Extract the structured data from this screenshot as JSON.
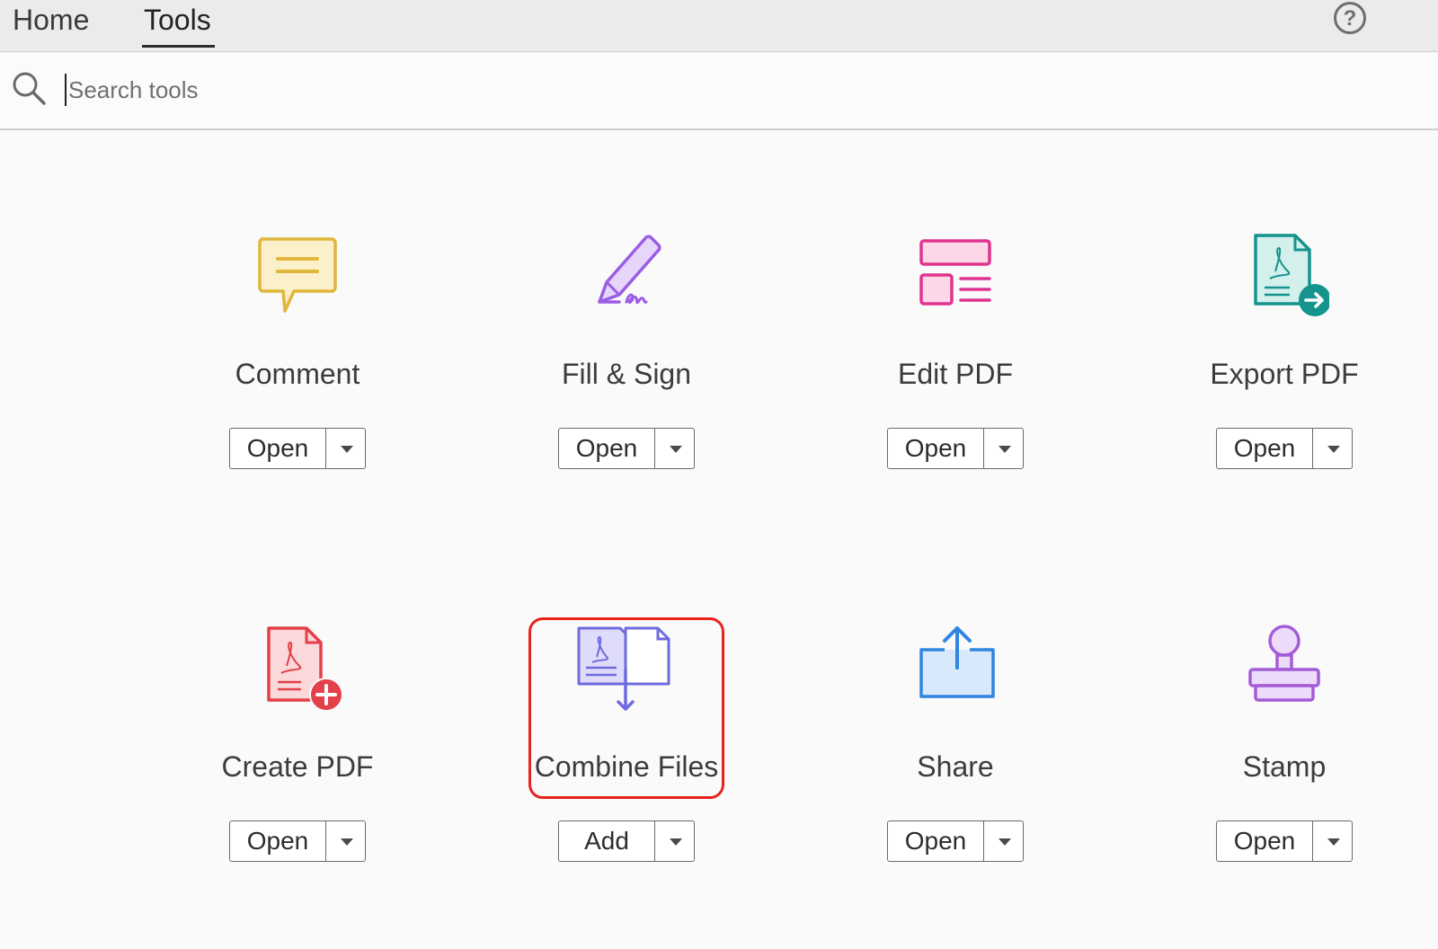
{
  "tabs": {
    "home": "Home",
    "tools": "Tools",
    "active": "Tools"
  },
  "help": {
    "icon": "help-icon",
    "glyph": "?"
  },
  "search": {
    "placeholder": "Search tools",
    "value": ""
  },
  "tools": [
    {
      "name": "Comment",
      "button": "Open",
      "icon": "comment-icon",
      "color": "#e0b73a"
    },
    {
      "name": "Fill & Sign",
      "button": "Open",
      "icon": "fill-sign-icon",
      "color": "#9b5de5"
    },
    {
      "name": "Edit PDF",
      "button": "Open",
      "icon": "edit-pdf-icon",
      "color": "#e0348e"
    },
    {
      "name": "Export PDF",
      "button": "Open",
      "icon": "export-pdf-icon",
      "color": "#14948c"
    },
    {
      "name": "Create PDF",
      "button": "Open",
      "icon": "create-pdf-icon",
      "color": "#e3404a"
    },
    {
      "name": "Combine Files",
      "button": "Add",
      "icon": "combine-files-icon",
      "color": "#6e6bde",
      "highlighted": true
    },
    {
      "name": "Share",
      "button": "Open",
      "icon": "share-icon",
      "color": "#2f85e0"
    },
    {
      "name": "Stamp",
      "button": "Open",
      "icon": "stamp-icon",
      "color": "#a35dd6"
    }
  ]
}
